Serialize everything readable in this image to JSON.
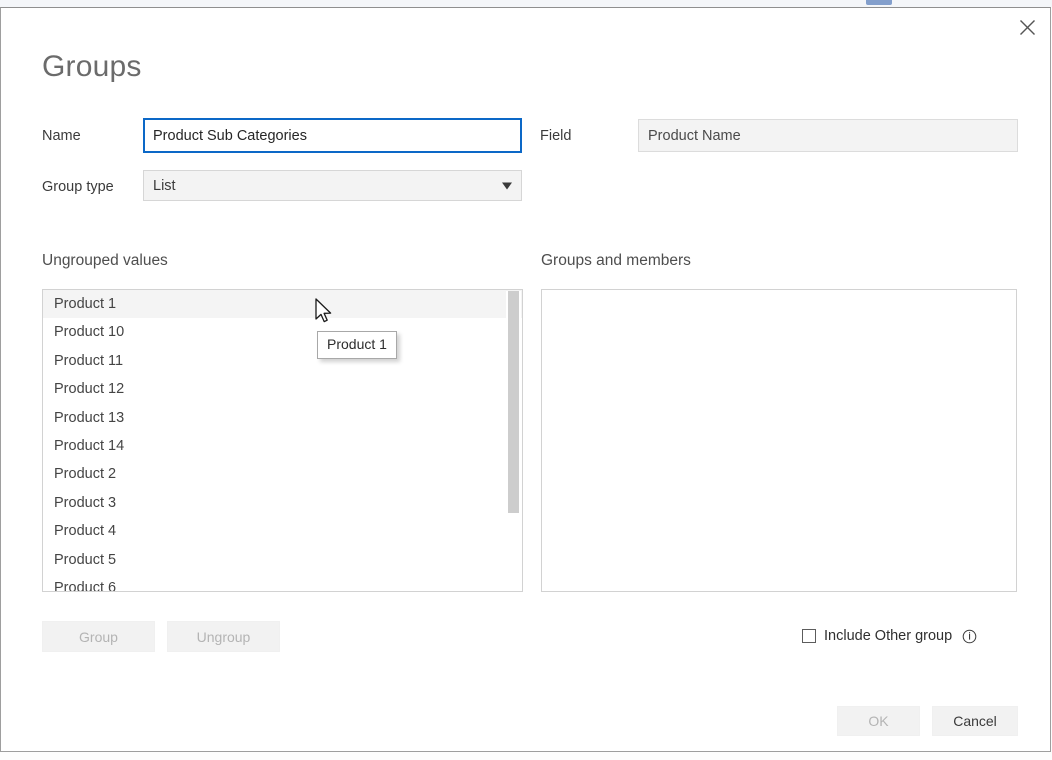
{
  "dialog": {
    "title": "Groups",
    "close_icon": "close-icon"
  },
  "form": {
    "name_label": "Name",
    "name_value": "Product Sub Categories",
    "field_label": "Field",
    "field_value": "Product Name",
    "group_type_label": "Group type",
    "group_type_value": "List",
    "group_type_arrow_icon": "chevron-down-icon"
  },
  "ungrouped": {
    "heading": "Ungrouped values",
    "items": [
      "Product 1",
      "Product 10",
      "Product 11",
      "Product 12",
      "Product 13",
      "Product 14",
      "Product 2",
      "Product 3",
      "Product 4",
      "Product 5",
      "Product 6"
    ],
    "hovered_index": 0
  },
  "groups_panel": {
    "heading": "Groups and members",
    "members": []
  },
  "actions": {
    "group_label": "Group",
    "group_enabled": false,
    "ungroup_label": "Ungroup",
    "ungroup_enabled": false,
    "ok_label": "OK",
    "ok_enabled": false,
    "cancel_label": "Cancel",
    "cancel_enabled": true
  },
  "include_other": {
    "label": "Include Other group",
    "checked": false,
    "info_icon": "info-icon"
  },
  "tooltip": {
    "text": "Product 1"
  },
  "cursor": {
    "icon": "arrow-pointer-icon"
  },
  "colors": {
    "focus_border": "#0c68c7",
    "dialog_border": "#9e9e9e",
    "title_text": "#6b6b6b",
    "disabled_text": "#b4b4b4",
    "scrollbar_thumb": "#cdcdcd"
  }
}
